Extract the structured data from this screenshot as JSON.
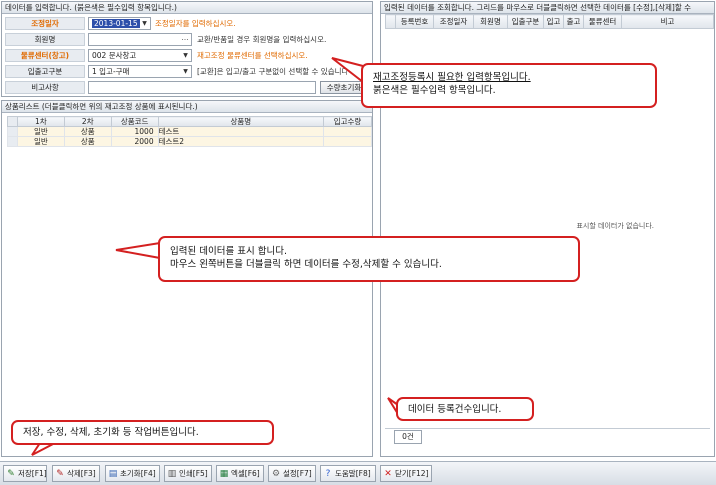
{
  "input_panel": {
    "header": "데이터를 입력합니다. (붉은색은 필수입력 항목입니다.)",
    "rows": [
      {
        "label": "조정일자",
        "value": "2013-01-15",
        "hint": "조정일자를 입력하십시오."
      },
      {
        "label": "회원명",
        "value": "",
        "hint": "교환/반품일 경우 회원명을 입력하십시오."
      },
      {
        "label": "물류센터(창고)",
        "value": "002 문사창고",
        "hint": "재고조정 물류센터를 선택하십시오."
      },
      {
        "label": "입출고구분",
        "value": "1 입고-구매",
        "hint": "[교환]은 입고/출고 구분없이 선택할 수 있습니다."
      },
      {
        "label": "비고사항",
        "value": "",
        "button": "수량초기화"
      }
    ]
  },
  "list_panel": {
    "header": "상품리스트 (더블클릭하면 위의 재고조정 상품에 표시된니다.)",
    "columns": [
      "1차",
      "2차",
      "상품코드",
      "상품명",
      "입고수량"
    ],
    "rows": [
      [
        "일반",
        "상품",
        "1000",
        "테스트",
        ""
      ],
      [
        "일반",
        "상품",
        "2000",
        "테스트2",
        ""
      ]
    ]
  },
  "query_panel": {
    "header": "입력된 데이터를 조회합니다. 그리드를 마우스로 더블클릭하면 선택한 데이터를 [수정],[삭제]할 수",
    "columns": [
      "등록번호",
      "조정일자",
      "회원명",
      "입출구분",
      "입고",
      "출고",
      "물류센터",
      "비고"
    ],
    "empty_message": "표시할 데이터가 없습니다.",
    "count_label": "0건"
  },
  "toolbar": {
    "buttons": [
      {
        "label": "저장[F1]",
        "icon": "save-icon",
        "glyph": "✎",
        "color": "#2a7a2a"
      },
      {
        "label": "삭제[F3]",
        "icon": "delete-icon",
        "glyph": "✎",
        "color": "#b02020"
      },
      {
        "label": "초기화[F4]",
        "icon": "reset-icon",
        "glyph": "▤",
        "color": "#3060b0"
      },
      {
        "label": "인쇄[F5]",
        "icon": "print-icon",
        "glyph": "▥",
        "color": "#555555"
      },
      {
        "label": "엑셀[F6]",
        "icon": "excel-icon",
        "glyph": "▦",
        "color": "#1f7a3a"
      },
      {
        "label": "설정[F7]",
        "icon": "settings-icon",
        "glyph": "⚙",
        "color": "#666666"
      },
      {
        "label": "도움말[F8]",
        "icon": "help-icon",
        "glyph": "?",
        "color": "#2f5fd0"
      },
      {
        "label": "닫기[F12]",
        "icon": "close-icon",
        "glyph": "✕",
        "color": "#d02020"
      }
    ]
  },
  "callouts": {
    "required_fields": [
      "재고조정등록시 필요한 입력항목입니다.",
      "붉은색은 필수입력 항목입니다."
    ],
    "list_display": [
      "입력된 데이터를 표시 합니다.",
      "마우스 왼쪽버튼을 더블클릭 하면 데이터를 수정,삭제할 수 있습니다."
    ],
    "count_display": [
      "데이터 등록건수입니다."
    ],
    "toolbar_buttons": [
      "저장, 수정, 삭제, 초기화  등 작업버튼입니다."
    ]
  },
  "colors": {
    "accent_required": "#e06a00",
    "callout_border": "#d42020"
  }
}
